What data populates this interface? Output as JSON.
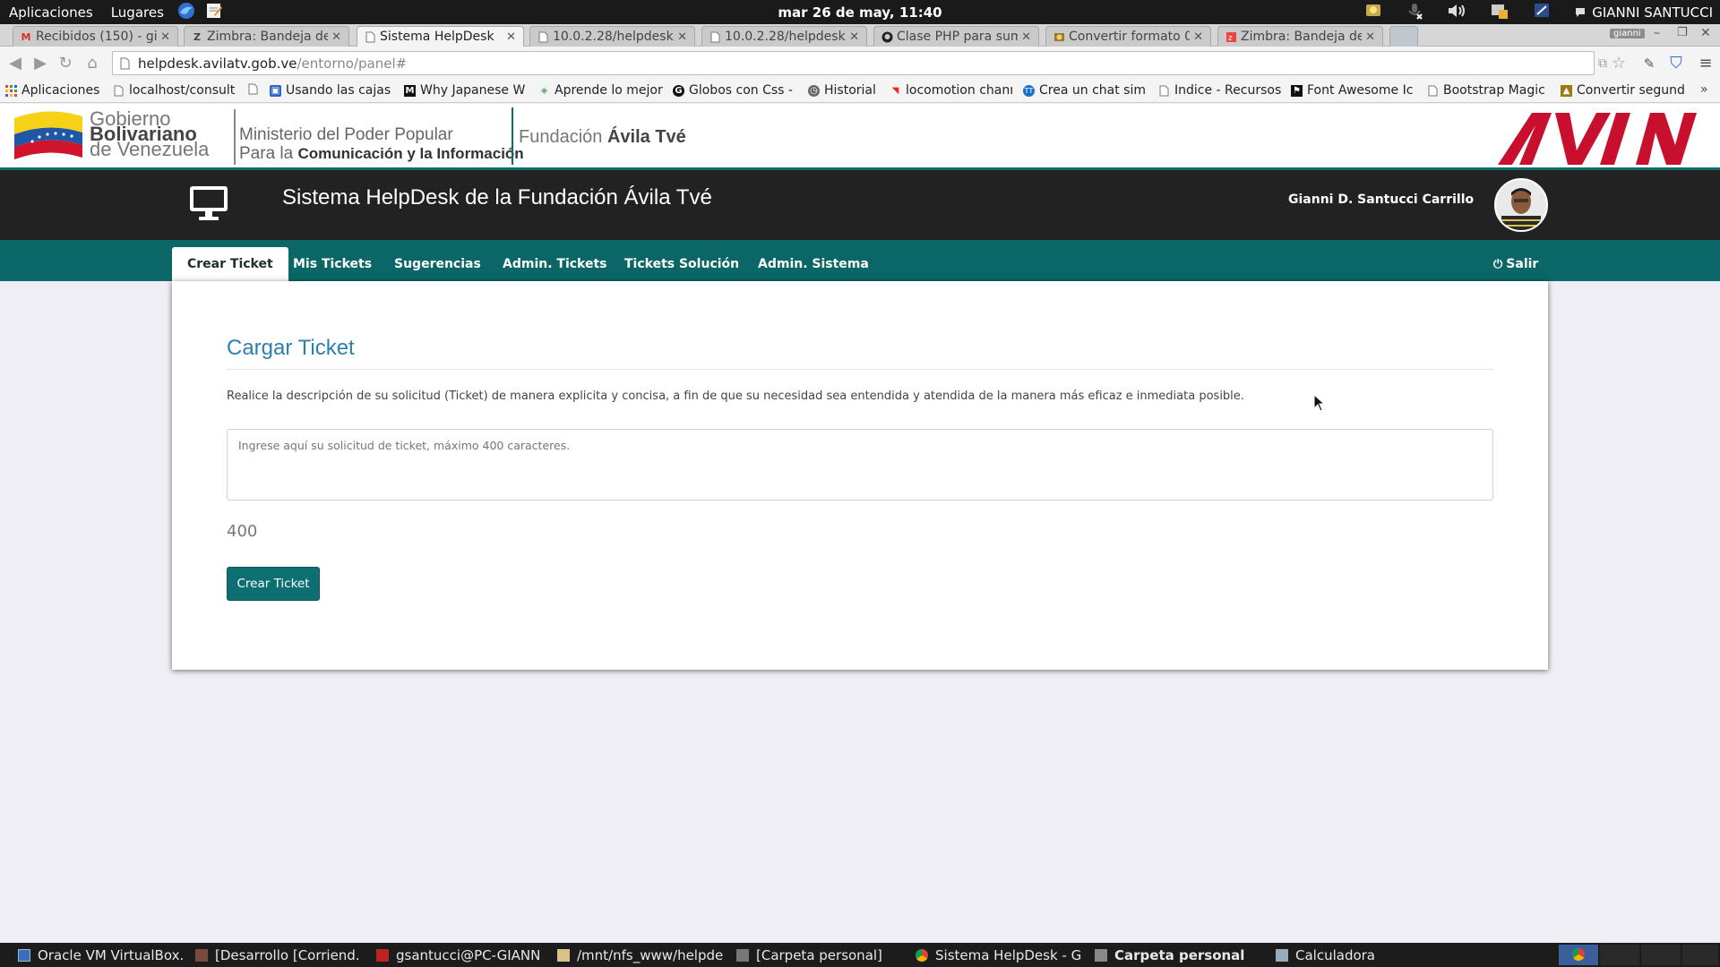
{
  "top_panel": {
    "menus": [
      "Aplicaciones",
      "Lugares"
    ],
    "clock": "mar 26 de may, 11:40",
    "user": "GIANNI SANTUCCI"
  },
  "tabs": [
    {
      "label": "Recibidos (150) - gi",
      "icon": "gmail-icon",
      "active": false
    },
    {
      "label": "Zimbra: Bandeja de e",
      "icon": "zimbra-icon",
      "active": false
    },
    {
      "label": "Sistema HelpDesk",
      "icon": "page-icon",
      "active": true
    },
    {
      "label": "10.0.2.28/helpdesk",
      "icon": "page-icon",
      "active": false
    },
    {
      "label": "10.0.2.28/helpdesk",
      "icon": "page-icon",
      "active": false
    },
    {
      "label": "Clase PHP para sum",
      "icon": "github-icon",
      "active": false
    },
    {
      "label": "Convertir formato 0",
      "icon": "site-icon",
      "active": false
    },
    {
      "label": "Zimbra: Bandeja de e",
      "icon": "zimbra-icon",
      "active": false
    }
  ],
  "profile_badge": "gianni",
  "address": {
    "host": "helpdesk.avilatv.gob.ve",
    "path": "/entorno/panel#"
  },
  "bookmarks": [
    {
      "label": "Aplicaciones",
      "icon": "apps-grid-icon"
    },
    {
      "label": "localhost/consult",
      "icon": "page-icon"
    },
    {
      "label": "",
      "icon": "page-icon"
    },
    {
      "label": "Usando las cajas f",
      "icon": "site-icon"
    },
    {
      "label": "Why Japanese W",
      "icon": "medium-icon"
    },
    {
      "label": "Aprende lo mejor",
      "icon": "site-icon"
    },
    {
      "label": "Globos con Css -",
      "icon": "site-icon"
    },
    {
      "label": "Historial",
      "icon": "clock-icon"
    },
    {
      "label": "locomotion chann",
      "icon": "site-icon"
    },
    {
      "label": "Crea un chat simil",
      "icon": "site-icon"
    },
    {
      "label": "Indice - Recursos",
      "icon": "page-icon"
    },
    {
      "label": "Font Awesome Ic",
      "icon": "flag-icon"
    },
    {
      "label": "Bootstrap Magic",
      "icon": "page-icon"
    },
    {
      "label": "Convertir segund",
      "icon": "site-icon"
    }
  ],
  "banner": {
    "gov_line1": "Gobierno",
    "gov_line2": "Bolivariano",
    "gov_line3": "de Venezuela",
    "ministry_line1": "Ministerio del Poder Popular",
    "ministry_line2_a": "Para la ",
    "ministry_line2_b": "Comunicación y la Información",
    "foundation_a": "Fundación ",
    "foundation_b": "Ávila Tvé",
    "brand_logo": "avila"
  },
  "app": {
    "title": "Sistema HelpDesk de la Fundación Ávila Tvé",
    "user_name": "Gianni D. Santucci Carrillo"
  },
  "nav": {
    "items": [
      {
        "label": "Crear Ticket",
        "active": true
      },
      {
        "label": "Mis Tickets",
        "active": false
      },
      {
        "label": "Sugerencias",
        "active": false
      },
      {
        "label": "Admin. Tickets",
        "active": false
      },
      {
        "label": "Tickets Solución",
        "active": false
      },
      {
        "label": "Admin. Sistema",
        "active": false
      }
    ],
    "logout": "Salir"
  },
  "form": {
    "heading": "Cargar Ticket",
    "description": "Realice la descripción de su solicitud (Ticket) de manera explicita y concisa, a fin de que su necesidad sea entendida y atendida de la manera más eficaz e inmediata posible.",
    "textarea_value": "",
    "textarea_placeholder": "Ingrese aquí su solicitud de ticket, máximo 400 caracteres.",
    "char_counter": "400",
    "submit_label": "Crear Ticket"
  },
  "taskbar": [
    {
      "label": "Oracle VM VirtualBox...",
      "icon": "virtualbox-icon",
      "bold": false
    },
    {
      "label": "[Desarrollo [Corriend...",
      "icon": "vm-icon",
      "bold": false
    },
    {
      "label": "gsantucci@PC-GIANN...",
      "icon": "terminal-icon",
      "bold": false
    },
    {
      "label": "/mnt/nfs_www/helpde...",
      "icon": "editor-icon",
      "bold": false
    },
    {
      "label": "[Carpeta personal]",
      "icon": "folder-icon",
      "bold": false
    },
    {
      "label": "Sistema HelpDesk - G...",
      "icon": "chrome-icon",
      "bold": false
    },
    {
      "label": "Carpeta personal",
      "icon": "folder-icon",
      "bold": true
    },
    {
      "label": "Calculadora",
      "icon": "calculator-icon",
      "bold": false
    }
  ],
  "colors": {
    "header_dark": "#222222",
    "nav_teal": "#0b6667",
    "heading_blue": "#2d7fb0",
    "button_teal": "#0d6f72",
    "brand_red": "#c8102e"
  }
}
